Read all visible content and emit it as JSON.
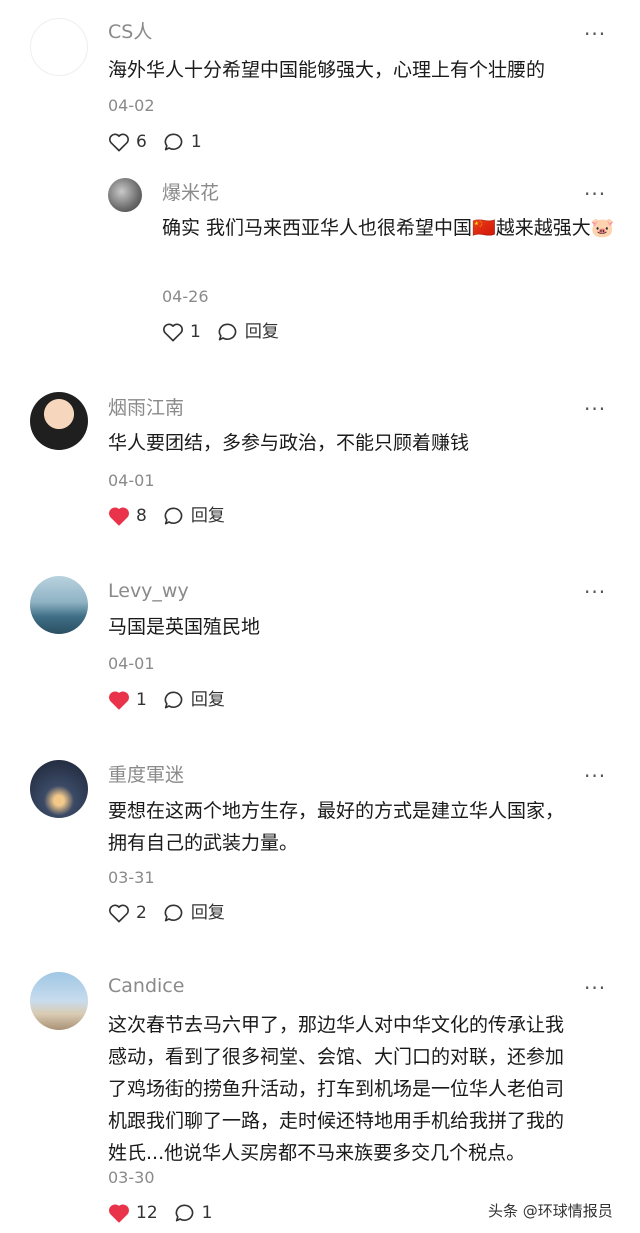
{
  "comments": [
    {
      "user": "CS人",
      "text": "海外华人十分希望中国能够强大，心理上有个壮腰的",
      "date": "04-02",
      "likes": "6",
      "liked": false,
      "reply_label": "1",
      "more": "···",
      "replies": [
        {
          "user": "爆米花",
          "text": "确实 我们马来西亚华人也很希望中国🇨🇳越来越强大🐷",
          "date": "04-26",
          "likes": "1",
          "liked": false,
          "reply_label": "回复",
          "more": "···"
        }
      ]
    },
    {
      "user": "烟雨江南",
      "text": "华人要团结，多参与政治，不能只顾着赚钱",
      "date": "04-01",
      "likes": "8",
      "liked": true,
      "reply_label": "回复",
      "more": "···"
    },
    {
      "user": "Levy_wy",
      "text": "马国是英国殖民地",
      "date": "04-01",
      "likes": "1",
      "liked": true,
      "reply_label": "回复",
      "more": "···"
    },
    {
      "user": "重度軍迷",
      "text": "要想在这两个地方生存，最好的方式是建立华人国家，\n拥有自己的武装力量。",
      "date": "03-31",
      "likes": "2",
      "liked": false,
      "reply_label": "回复",
      "more": "···"
    },
    {
      "user": "Candice",
      "text": "这次春节去马六甲了，那边华人对中华文化的传承让我\n感动，看到了很多祠堂、会馆、大门口的对联，还参加\n了鸡场街的捞鱼升活动，打车到机场是一位华人老伯司\n机跟我们聊了一路，走时候还特地用手机给我拼了我的\n姓氏...他说华人买房都不马来族要多交几个税点。",
      "date": "03-30",
      "likes": "12",
      "liked": true,
      "reply_label": "1",
      "more": "···"
    }
  ],
  "watermark": "头条 @环球情报员",
  "colors": {
    "liked_heart": "#e8334a",
    "meta_gray": "#8a8a8a",
    "text": "#1a1a1a"
  }
}
